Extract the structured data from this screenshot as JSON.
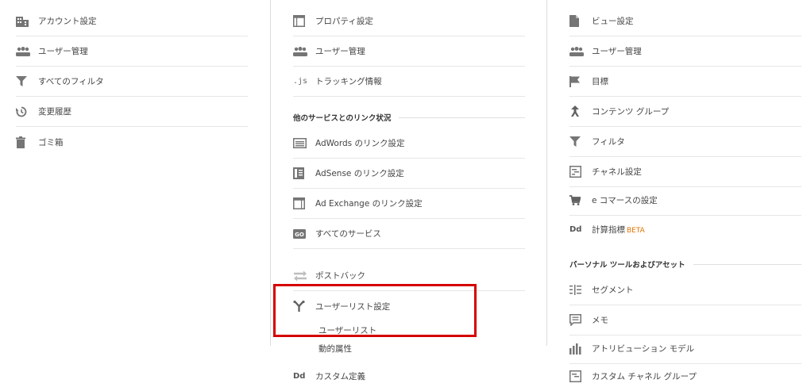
{
  "account": {
    "items": [
      {
        "label": "アカウント設定",
        "icon": "building-icon"
      },
      {
        "label": "ユーザー管理",
        "icon": "people-icon"
      },
      {
        "label": "すべてのフィルタ",
        "icon": "filter-icon"
      },
      {
        "label": "変更履歴",
        "icon": "history-icon"
      },
      {
        "label": "ゴミ箱",
        "icon": "trash-icon"
      }
    ]
  },
  "property": {
    "items": [
      {
        "label": "プロパティ設定",
        "icon": "window-icon"
      },
      {
        "label": "ユーザー管理",
        "icon": "people-icon"
      },
      {
        "label": "トラッキング情報",
        "icon": "js-icon",
        "icon_text": ".js"
      }
    ],
    "section_title": "他のサービスとのリンク状況",
    "links": [
      {
        "label": "AdWords のリンク設定",
        "icon": "adwords-icon"
      },
      {
        "label": "AdSense のリンク設定",
        "icon": "adsense-icon"
      },
      {
        "label": "Ad Exchange のリンク設定",
        "icon": "window-icon"
      },
      {
        "label": "すべてのサービス",
        "icon": "go-icon",
        "icon_text": "GO"
      }
    ],
    "postback": {
      "label": "ポストバック",
      "icon": "postback-icon"
    },
    "userlist": {
      "label": "ユーザーリスト設定",
      "icon": "fork-icon",
      "children": [
        "ユーザーリスト",
        "動的属性"
      ]
    },
    "custom": {
      "label": "カスタム定義",
      "icon": "dd-icon",
      "icon_text": "Dd"
    }
  },
  "view": {
    "items": [
      {
        "label": "ビュー設定",
        "icon": "document-icon"
      },
      {
        "label": "ユーザー管理",
        "icon": "people-icon"
      },
      {
        "label": "目標",
        "icon": "flag-icon"
      },
      {
        "label": "コンテンツ グループ",
        "icon": "person-arrow-icon"
      },
      {
        "label": "フィルタ",
        "icon": "filter-icon"
      },
      {
        "label": "チャネル設定",
        "icon": "channel-icon"
      },
      {
        "label": "e コマースの設定",
        "icon": "cart-icon"
      },
      {
        "label": "計算指標",
        "icon": "dd-icon",
        "icon_text": "Dd",
        "badge": "BETA"
      }
    ],
    "section_title": "パーソナル ツールおよびアセット",
    "tools": [
      {
        "label": "セグメント",
        "icon": "segment-icon"
      },
      {
        "label": "メモ",
        "icon": "note-icon"
      },
      {
        "label": "アトリビューション モデル",
        "icon": "bar-chart-icon"
      },
      {
        "label": "カスタム チャネル グループ",
        "icon": "channel-icon"
      }
    ]
  },
  "colors": {
    "highlight": "#d50000",
    "icon": "#757575",
    "beta": "#e37400"
  }
}
